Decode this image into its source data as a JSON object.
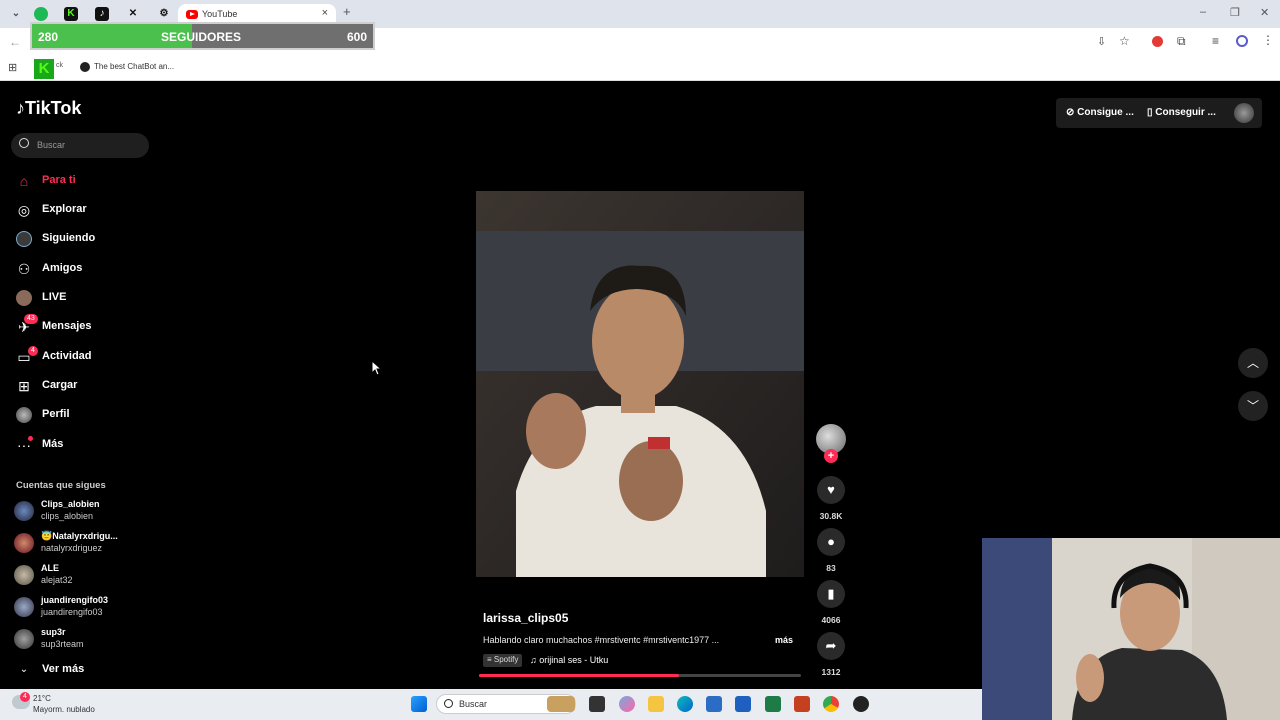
{
  "browser": {
    "active_tab_title": "YouTube",
    "bookmark_item": "The best ChatBot an...",
    "bookmark_overlay_text": "ck"
  },
  "follower_widget": {
    "current": "280",
    "label": "SEGUIDORES",
    "goal": "600",
    "progress_fraction": 0.47
  },
  "tiktok": {
    "logo": "TikTok",
    "search_placeholder": "Buscar",
    "nav": [
      {
        "label": "Para ti",
        "icon": "home-icon",
        "active": true
      },
      {
        "label": "Explorar",
        "icon": "compass-icon"
      },
      {
        "label": "Siguiendo",
        "icon": "following-avatar-icon"
      },
      {
        "label": "Amigos",
        "icon": "friends-icon"
      },
      {
        "label": "LIVE",
        "icon": "live-avatar-icon"
      },
      {
        "label": "Mensajes",
        "icon": "messages-icon",
        "badge": "43"
      },
      {
        "label": "Actividad",
        "icon": "activity-icon",
        "badge": "4"
      },
      {
        "label": "Cargar",
        "icon": "upload-icon"
      },
      {
        "label": "Perfil",
        "icon": "profile-avatar-icon"
      },
      {
        "label": "Más",
        "icon": "more-icon"
      }
    ],
    "accounts_title": "Cuentas que sigues",
    "accounts": [
      {
        "name": "Clips_alobien",
        "handle": "clips_alobien"
      },
      {
        "name": "Natalyrxdrigu...",
        "handle": "natalyrxdriguez"
      },
      {
        "name": "ALE",
        "handle": "alejat32"
      },
      {
        "name": "juandirengifo03",
        "handle": "juandirengifo03"
      },
      {
        "name": "sup3r",
        "handle": "sup3rteam"
      }
    ],
    "see_more": "Ver más",
    "header_buttons": [
      "Consigue ...",
      "Conseguir ..."
    ],
    "video": {
      "username": "larissa_clips05",
      "caption": "Hablando claro muchachos #mrstiventc #mrstiventc1977 ...",
      "more": "más",
      "spotify": "Spotify",
      "sound": "orijinal ses - Utku",
      "progress_fraction": 0.62,
      "likes": "30.8K",
      "comments": "83",
      "saves": "4066",
      "shares": "1312"
    }
  },
  "taskbar": {
    "weather_temp": "21°C",
    "weather_desc": "Mayorm. nublado",
    "weather_badge": "4",
    "search_placeholder": "Buscar"
  },
  "colors": {
    "accent": "#fe2c55",
    "follow_green": "#4cc04c"
  }
}
